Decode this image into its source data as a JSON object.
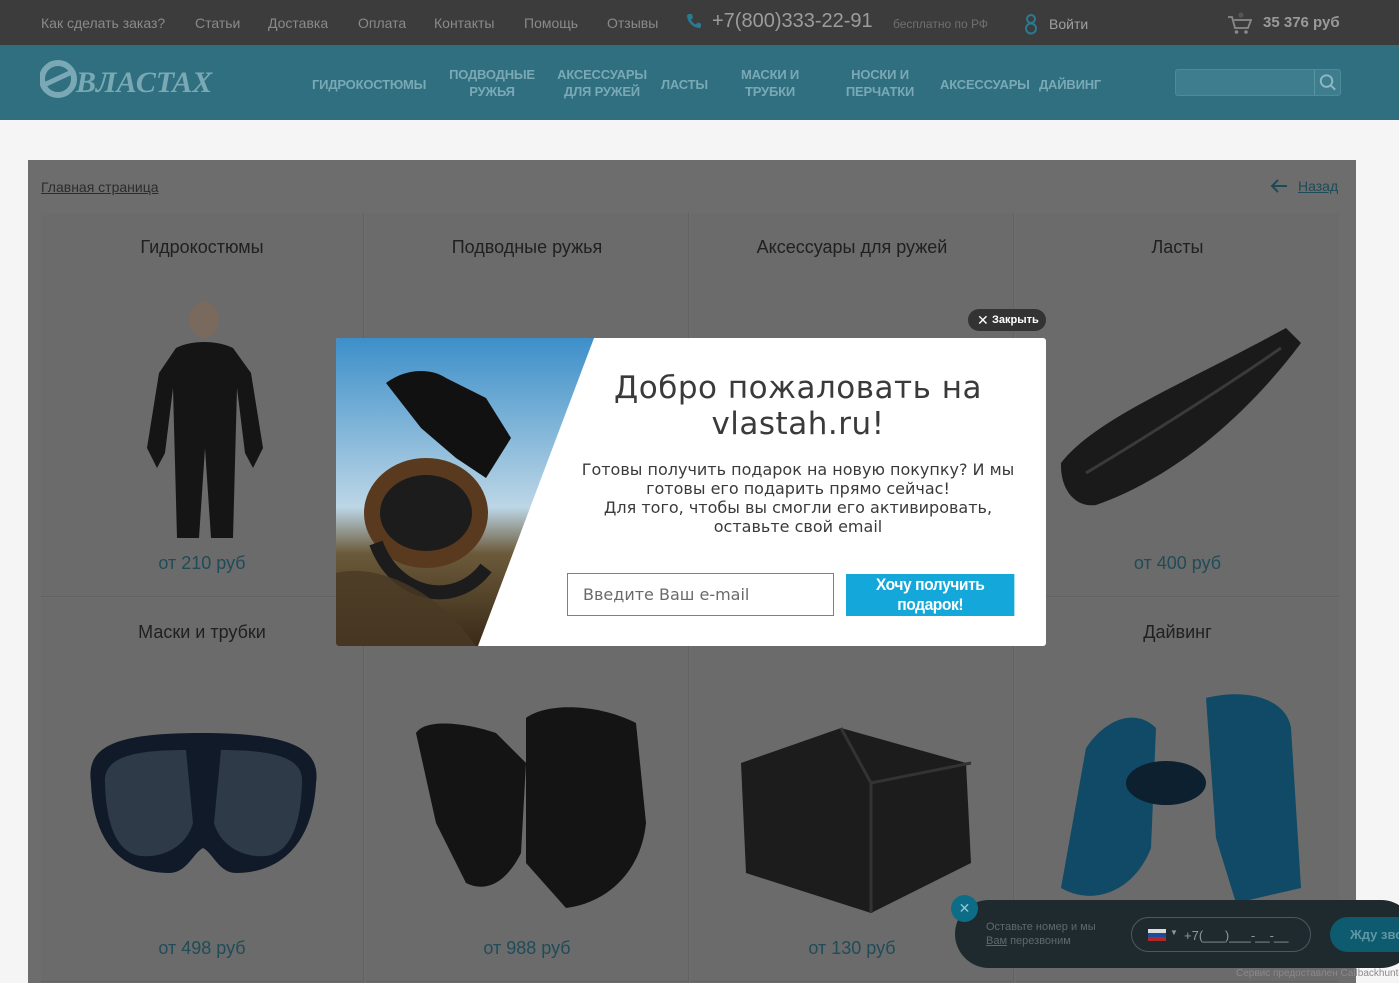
{
  "topbar": {
    "links": [
      "Как сделать заказ?",
      "Статьи",
      "Доставка",
      "Оплата",
      "Контакты",
      "Помощь",
      "Отзывы"
    ],
    "phone": "+7(800)333-22-91",
    "phone_note": "бесплатно по РФ",
    "login": "Войти",
    "cart_total": "35 376 руб"
  },
  "header": {
    "logo": "ВЛАСТАХ",
    "menu": [
      "Гидрокостюмы",
      "Подводные ружья",
      "Аксессуары для ружей",
      "Ласты",
      "Маски и трубки",
      "Носки и перчатки",
      "Аксессуары",
      "Дайвинг"
    ],
    "search_placeholder": ""
  },
  "breadcrumb": "Главная страница",
  "back": "Назад",
  "cards": [
    {
      "title": "Гидрокостюмы",
      "price": "от 210 руб"
    },
    {
      "title": "Подводные ружья",
      "price": ""
    },
    {
      "title": "Аксессуары для ружей",
      "price": ""
    },
    {
      "title": "Ласты",
      "price": "от 400 руб"
    },
    {
      "title": "Маски и трубки",
      "price": "от 498 руб"
    },
    {
      "title": "",
      "price": "от 988 руб"
    },
    {
      "title": "",
      "price": "от 130 руб"
    },
    {
      "title": "Дайвинг",
      "price": ""
    }
  ],
  "modal": {
    "close": "Закрыть",
    "title": "Добро пожаловать на vlastah.ru!",
    "text_line1": "Готовы получить подарок на новую покупку? И мы готовы его подарить прямо сейчас!",
    "text_line2": "Для того, чтобы вы смогли его активировать, оставьте свой email",
    "email_placeholder": "Введите Ваш e-mail",
    "submit": "Хочу получить подарок!"
  },
  "callback": {
    "text": "Оставьте номер и мы",
    "text_link": "Вам",
    "text_rest": "перезвоним",
    "phone_mask": "+7(___)___-__-__",
    "call_button": "Жду звонка",
    "service": "Сервис предоставлен Callbackhunter"
  },
  "colors": {
    "accent": "#14a7da",
    "header": "#2f6f80",
    "topbar": "#3c3c3c"
  }
}
